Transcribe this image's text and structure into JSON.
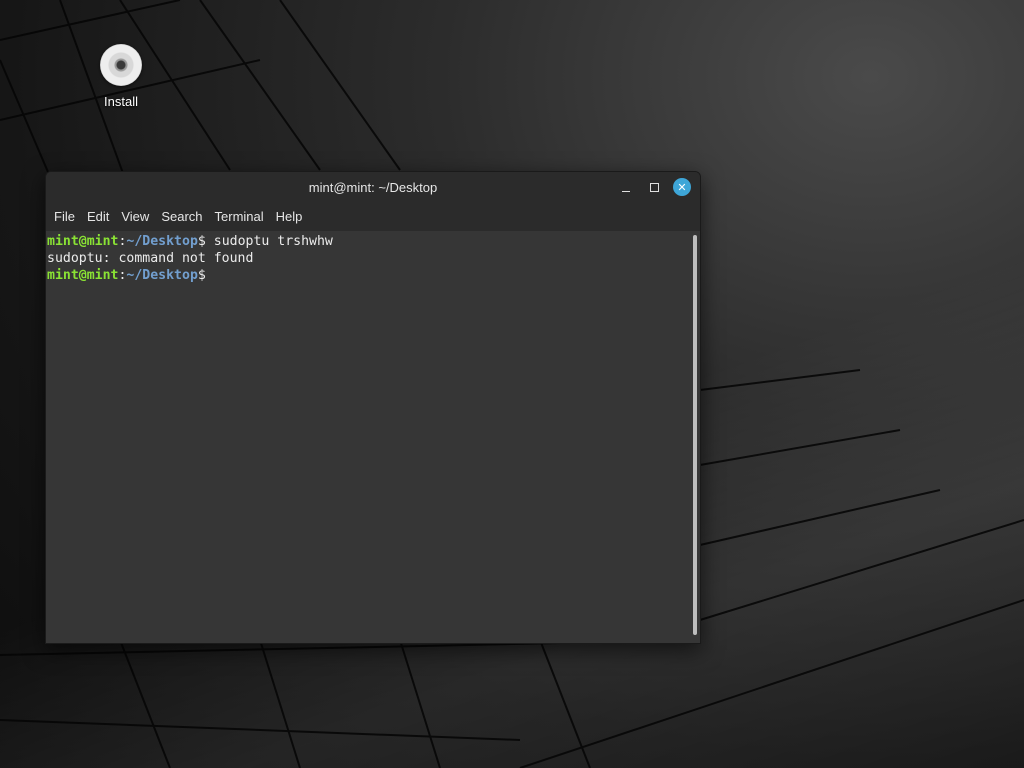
{
  "desktop": {
    "icons": [
      {
        "label": "Install",
        "icon": "disc-icon"
      }
    ]
  },
  "window": {
    "title": "mint@mint: ~/Desktop",
    "controls": {
      "minimize": "minimize-icon",
      "maximize": "maximize-icon",
      "close": "close-icon",
      "close_color": "#3ea6d8"
    },
    "menu": [
      "File",
      "Edit",
      "View",
      "Search",
      "Terminal",
      "Help"
    ]
  },
  "terminal": {
    "colors": {
      "background": "#363636",
      "user_host": "#8ae234",
      "path": "#729fcf",
      "text": "#ececec"
    },
    "lines": [
      {
        "user_host": "mint@mint",
        "sep": ":",
        "path": "~/Desktop",
        "dollar": "$",
        "command": " sudoptu trshwhw"
      },
      {
        "output": "sudoptu: command not found"
      },
      {
        "user_host": "mint@mint",
        "sep": ":",
        "path": "~/Desktop",
        "dollar": "$",
        "command": ""
      }
    ]
  }
}
